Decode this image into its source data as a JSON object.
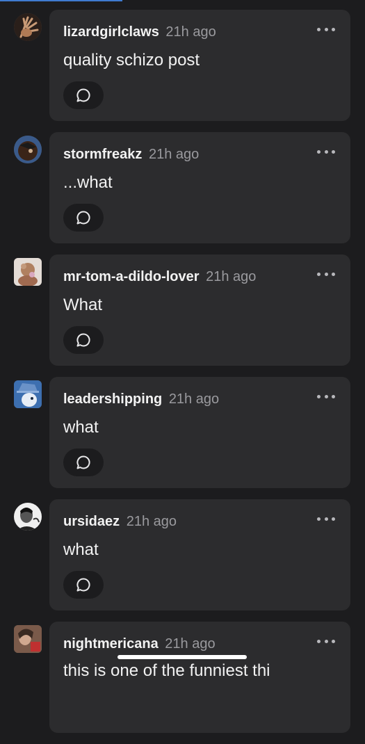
{
  "colors": {
    "background": "#1c1c1e",
    "bubble": "#2c2c2e",
    "accent": "#3f7bd1",
    "timestamp": "#9a9a9e"
  },
  "replies": [
    {
      "username": "lizardgirlclaws",
      "time": "21h ago",
      "text": "quality schizo post",
      "avatar_icon": "claw-hand-avatar"
    },
    {
      "username": "stormfreakz",
      "time": "21h ago",
      "text": "...what",
      "avatar_icon": "character-avatar"
    },
    {
      "username": "mr-tom-a-dildo-lover",
      "time": "21h ago",
      "text": "What",
      "avatar_icon": "illustration-avatar"
    },
    {
      "username": "leadershipping",
      "time": "21h ago",
      "text": "what",
      "avatar_icon": "hat-character-avatar"
    },
    {
      "username": "ursidaez",
      "time": "21h ago",
      "text": "what",
      "avatar_icon": "bw-photo-avatar"
    },
    {
      "username": "nightmericana",
      "time": "21h ago",
      "text": "this is one of the funniest thi",
      "avatar_icon": "photo-avatar"
    }
  ],
  "icons": {
    "more": "more-options-icon",
    "reply": "reply-speech-bubble-icon"
  }
}
